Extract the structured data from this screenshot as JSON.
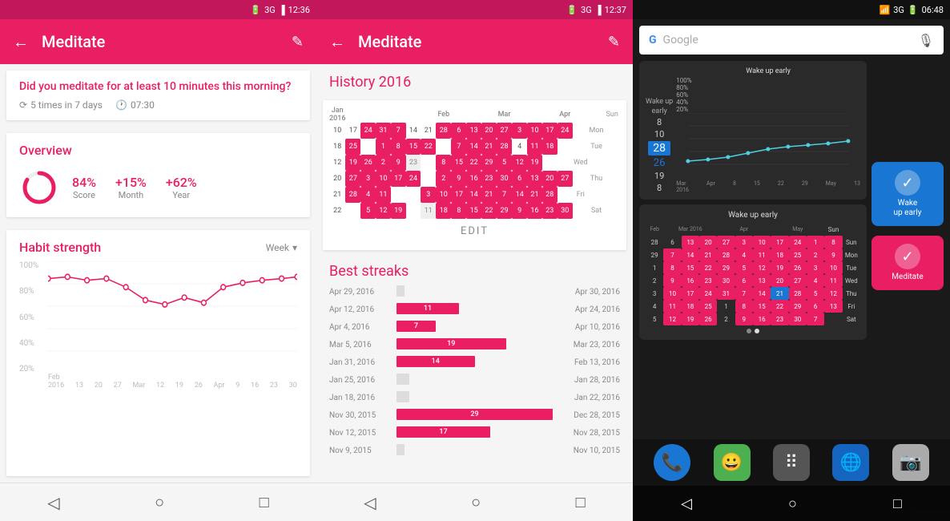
{
  "panel1": {
    "status": {
      "signal": "3G",
      "battery": "12:36"
    },
    "appbar": {
      "title": "Meditate",
      "back": "←",
      "edit": "✎"
    },
    "question": {
      "text": "Did you meditate for at least 10 minutes this morning?",
      "frequency": "5 times in 7 days",
      "time": "07:30"
    },
    "overview": {
      "title": "Overview",
      "score": {
        "value": "84%",
        "label": "Score"
      },
      "month": {
        "value": "+15%",
        "label": "Month"
      },
      "year": {
        "value": "+62%",
        "label": "Year"
      }
    },
    "habit_strength": {
      "title": "Habit strength",
      "period": "Week",
      "y_labels": [
        "100%",
        "80%",
        "60%",
        "40%",
        "20%"
      ],
      "x_labels": [
        "Feb 2016",
        "13",
        "20",
        "27",
        "Mar",
        "12",
        "19",
        "26",
        "Apr",
        "9",
        "16",
        "23",
        "30"
      ]
    },
    "nav": {
      "back": "◁",
      "home": "○",
      "recents": "□"
    }
  },
  "panel2": {
    "status": {
      "signal": "3G",
      "battery": "12:37"
    },
    "appbar": {
      "title": "Meditate",
      "back": "←",
      "edit": "✎"
    },
    "history": {
      "title": "History 2016",
      "edit_label": "EDIT"
    },
    "best_streaks": {
      "title": "Best streaks",
      "streaks": [
        {
          "start": "Apr 29, 2016",
          "count": "",
          "end": "Apr 30, 2016",
          "width": 5
        },
        {
          "start": "Apr 12, 2016",
          "count": "11",
          "end": "Apr 24, 2016",
          "width": 40
        },
        {
          "start": "Apr 4, 2016",
          "count": "7",
          "end": "Apr 10, 2016",
          "width": 25
        },
        {
          "start": "Mar 5, 2016",
          "count": "19",
          "end": "Mar 23, 2016",
          "width": 70
        },
        {
          "start": "Jan 31, 2016",
          "count": "14",
          "end": "Feb 13, 2016",
          "width": 50
        },
        {
          "start": "Jan 25, 2016",
          "count": "",
          "end": "Jan 28, 2016",
          "width": 8
        },
        {
          "start": "Jan 18, 2016",
          "count": "",
          "end": "Jan 22, 2016",
          "width": 8
        },
        {
          "start": "Nov 30, 2015",
          "count": "29",
          "end": "Dec 28, 2015",
          "width": 100
        },
        {
          "start": "Nov 12, 2015",
          "count": "17",
          "end": "Nov 28, 2015",
          "width": 60
        },
        {
          "start": "Nov 9, 2015",
          "count": "",
          "end": "Nov 10, 2015",
          "width": 5
        }
      ]
    },
    "nav": {
      "back": "◁",
      "home": "○",
      "recents": "□"
    }
  },
  "panel3": {
    "status": {
      "signal": "3G",
      "battery": "06:48"
    },
    "google_placeholder": "Google",
    "wake_early_widget": {
      "title": "Wake up early",
      "numbers": [
        8,
        10,
        28,
        26,
        19,
        8
      ],
      "y_labels": [
        "100%",
        "80%",
        "60%",
        "40%",
        "20%"
      ],
      "x_labels": [
        "Mar 2016",
        "Apr",
        "8",
        "15",
        "22",
        "29",
        "May",
        "13"
      ]
    },
    "wake_early_btn": {
      "title": "Wake\nup early",
      "check": "✓"
    },
    "meditate_btn": {
      "title": "Meditate",
      "check": "✓"
    },
    "mini_cal_title": "Wake up early",
    "nav": {
      "back": "◁",
      "home": "○",
      "recents": "□"
    },
    "apps": [
      "📞",
      "😀",
      "⠿",
      "🌐",
      "📷"
    ]
  }
}
